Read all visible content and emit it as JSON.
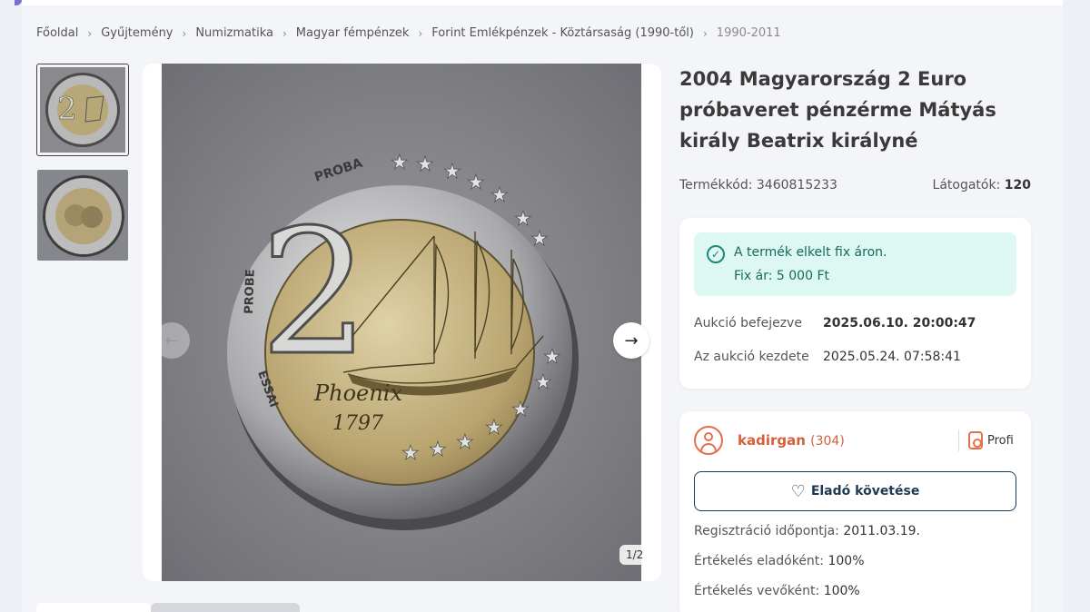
{
  "breadcrumb": [
    "Főoldal",
    "Gyűjtemény",
    "Numizmatika",
    "Magyar fémpénzek",
    "Forint Emlékpénzek - Köztársaság (1990-től)",
    "1990-2011"
  ],
  "product": {
    "title": "2004 Magyarország 2 Euro próbaveret pénzérme Mátyás király Beatrix királyné",
    "code_label": "Termékkód:",
    "code": "3460815233",
    "visitors_label": "Látogatók:",
    "visitors": "120"
  },
  "gallery": {
    "counter": "1/2",
    "coin_text": {
      "value": "2",
      "top": "PROBA",
      "left": "PROBE",
      "bottom_left": "ESSAI",
      "ship": "Phoenix",
      "year": "1797"
    }
  },
  "auction": {
    "sold_line1": "A termék elkelt fix áron.",
    "sold_line2": "Fix ár: 5 000 Ft",
    "end_label": "Aukció befejezve",
    "end_value": "2025.06.10. 20:00:47",
    "start_label": "Az aukció kezdete",
    "start_value": "2025.05.24. 07:58:41"
  },
  "seller": {
    "name": "kadirgan",
    "count": "(304)",
    "badge": "Profi",
    "follow_label": "Eladó követése",
    "reg_label": "Regisztráció időpontja:",
    "reg_value": "2011.03.19.",
    "seller_rating_label": "Értékelés eladóként:",
    "seller_rating_value": "100%",
    "buyer_rating_label": "Értékelés vevőként:",
    "buyer_rating_value": "100%"
  },
  "colors": {
    "accent": "#d65f3c",
    "success_bg": "#ddf7f2",
    "success_text": "#18695b",
    "button_border": "#1d3a52"
  }
}
